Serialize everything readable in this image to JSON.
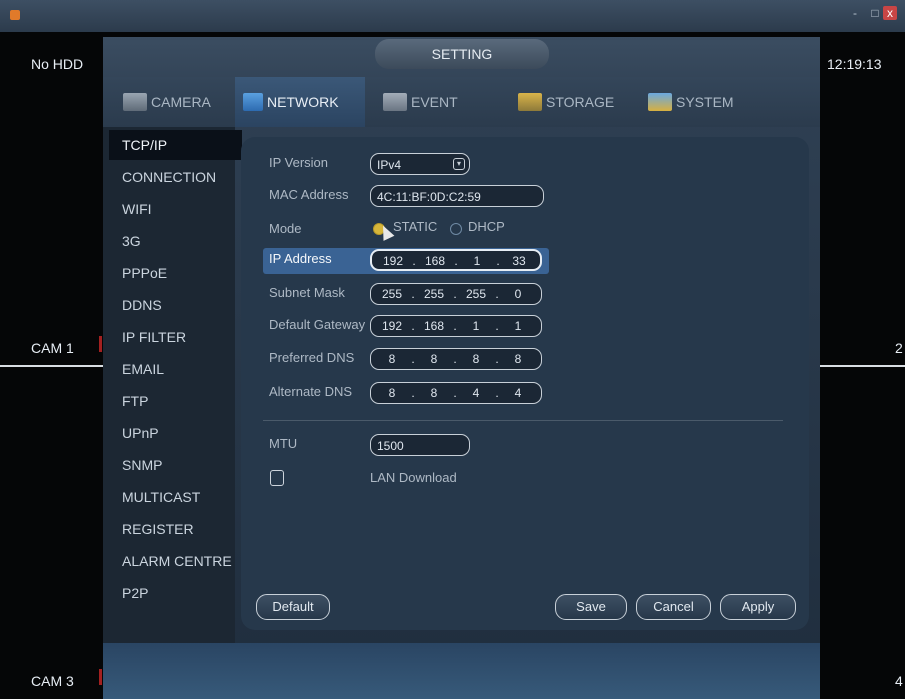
{
  "window": {
    "min": "-",
    "max": "□",
    "close": "x"
  },
  "overlay": {
    "hdd_status": "No HDD",
    "clock": "12:19:13",
    "cam1": "CAM 1",
    "cam2_num": "2",
    "cam3": "CAM 3",
    "cam4_num": "4"
  },
  "dialog": {
    "title": "SETTING",
    "tabs": [
      {
        "label": "CAMERA",
        "icon": "camera-icon"
      },
      {
        "label": "NETWORK",
        "icon": "network-icon"
      },
      {
        "label": "EVENT",
        "icon": "event-icon"
      },
      {
        "label": "STORAGE",
        "icon": "storage-icon"
      },
      {
        "label": "SYSTEM",
        "icon": "system-icon"
      }
    ],
    "active_tab": "NETWORK"
  },
  "sidebar": {
    "items": [
      "TCP/IP",
      "CONNECTION",
      "WIFI",
      "3G",
      "PPPoE",
      "DDNS",
      "IP FILTER",
      "EMAIL",
      "FTP",
      "UPnP",
      "SNMP",
      "MULTICAST",
      "REGISTER",
      "ALARM CENTRE",
      "P2P"
    ],
    "active": "TCP/IP"
  },
  "form": {
    "ip_version_label": "IP Version",
    "ip_version_value": "IPv4",
    "mac_label": "MAC Address",
    "mac_value": "4C:11:BF:0D:C2:59",
    "mode_label": "Mode",
    "mode_static": "STATIC",
    "mode_dhcp": "DHCP",
    "ip_label": "IP Address",
    "ip": [
      "192",
      "168",
      "1",
      "33"
    ],
    "subnet_label": "Subnet Mask",
    "subnet": [
      "255",
      "255",
      "255",
      "0"
    ],
    "gateway_label": "Default Gateway",
    "gateway": [
      "192",
      "168",
      "1",
      "1"
    ],
    "pref_dns_label": "Preferred DNS",
    "pref_dns": [
      "8",
      "8",
      "8",
      "8"
    ],
    "alt_dns_label": "Alternate DNS",
    "alt_dns": [
      "8",
      "8",
      "4",
      "4"
    ],
    "mtu_label": "MTU",
    "mtu_value": "1500",
    "lan_download_label": "LAN Download"
  },
  "buttons": {
    "default": "Default",
    "save": "Save",
    "cancel": "Cancel",
    "apply": "Apply"
  },
  "colors": {
    "active_row": "#3a6394",
    "radio_selected": "#d7b63a",
    "close_button": "#c84545"
  }
}
